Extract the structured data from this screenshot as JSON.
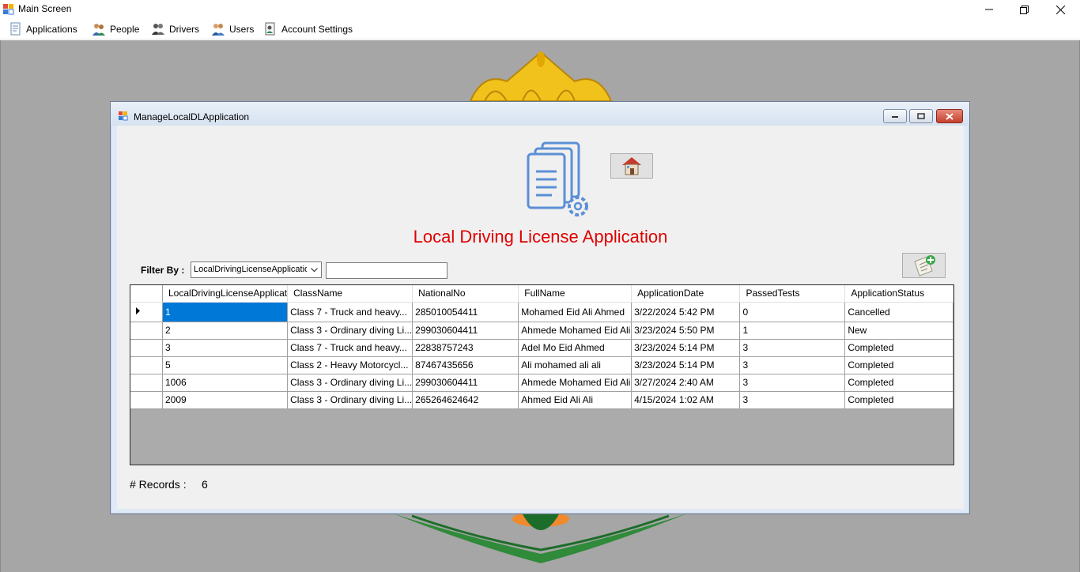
{
  "window": {
    "title": "Main Screen"
  },
  "menu": [
    {
      "label": "Applications",
      "icon": "applications-icon"
    },
    {
      "label": "People",
      "icon": "people-icon"
    },
    {
      "label": "Drivers",
      "icon": "drivers-icon"
    },
    {
      "label": "Users",
      "icon": "users-icon"
    },
    {
      "label": "Account Settings",
      "icon": "account-settings-icon"
    }
  ],
  "child": {
    "title": "ManageLocalDLApplication",
    "heading": "Local Driving License Application",
    "filter": {
      "label": "Filter By :",
      "selected": "LocalDrivingLicenseApplicatio",
      "value": ""
    }
  },
  "grid": {
    "columns": [
      "LocalDrivingLicenseApplicat",
      "ClassName",
      "NationalNo",
      "FullName",
      "ApplicationDate",
      "PassedTests",
      "ApplicationStatus"
    ],
    "rows": [
      [
        "1",
        "Class 7 - Truck and heavy...",
        "285010054411",
        "Mohamed Eid Ali Ahmed",
        "3/22/2024 5:42 PM",
        "0",
        "Cancelled"
      ],
      [
        "2",
        "Class 3 - Ordinary diving Li...",
        "299030604411",
        "Ahmede Mohamed Eid Ali",
        "3/23/2024 5:50 PM",
        "1",
        "New"
      ],
      [
        "3",
        "Class 7 - Truck and heavy...",
        "22838757243",
        "Adel Mo Eid Ahmed",
        "3/23/2024 5:14 PM",
        "3",
        "Completed"
      ],
      [
        "5",
        "Class 2 - Heavy Motorcycl...",
        "87467435656",
        "Ali mohamed ali ali",
        "3/23/2024 5:14 PM",
        "3",
        "Completed"
      ],
      [
        "1006",
        "Class 3 - Ordinary diving Li...",
        "299030604411",
        "Ahmede Mohamed Eid Ali",
        "3/27/2024 2:40 AM",
        "3",
        "Completed"
      ],
      [
        "2009",
        "Class 3 - Ordinary diving Li...",
        "265264624642",
        "Ahmed Eid Ali Ali",
        "4/15/2024 1:02 AM",
        "3",
        "Completed"
      ]
    ]
  },
  "records": {
    "label": "# Records :",
    "count": "6"
  },
  "colors": {
    "title_red": "#e00000",
    "selection_blue": "#0078d7",
    "mdi_gray": "#a6a6a6"
  }
}
